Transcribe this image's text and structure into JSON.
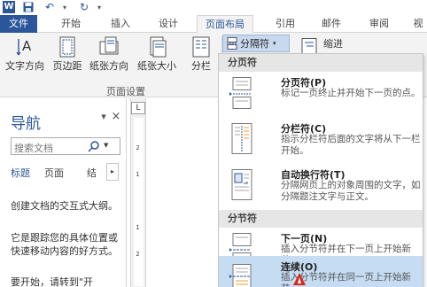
{
  "qat": {
    "save": "",
    "undo": "↶",
    "redo": "↻"
  },
  "tabs": [
    "文件",
    "开始",
    "插入",
    "设计",
    "页面布局",
    "引用",
    "邮件",
    "审阅",
    "视"
  ],
  "ribbon": {
    "buttons": [
      {
        "label": "文字方向"
      },
      {
        "label": "页边距"
      },
      {
        "label": "纸张方向"
      },
      {
        "label": "纸张大小"
      },
      {
        "label": "分栏"
      }
    ],
    "group_label": "页面设置",
    "breaks_label": "分隔符",
    "indent_label": "缩进"
  },
  "nav": {
    "title": "导航",
    "search_placeholder": "搜索文档",
    "tabs": [
      "标题",
      "页面",
      "结"
    ],
    "text1": "创建文档的交互式大纲。",
    "text2": "它是跟踪您的具体位置或快速移动内容的好方式。",
    "text3": "要开始，请转到\"开"
  },
  "ruler_numbers": [
    "2",
    "1",
    "1",
    "2"
  ],
  "menu": {
    "section1": "分页符",
    "section2": "分节符",
    "items": [
      {
        "title": "分页符(P)",
        "desc": "标记一页终止并开始下一页的点。"
      },
      {
        "title": "分栏符(C)",
        "desc": "指示分栏符后面的文字将从下一栏开始。"
      },
      {
        "title": "自动换行符(T)",
        "desc": "分隔网页上的对象周围的文字，如分隔题注文字与正文。"
      },
      {
        "title": "下一页(N)",
        "desc": "插入分节符并在下一页上开始新节。"
      },
      {
        "title": "连续(O)",
        "desc": "插入分节符并在同一页上开始新节。"
      }
    ]
  },
  "colors": {
    "accent": "#2b579a",
    "hover": "#c5dcf2"
  }
}
